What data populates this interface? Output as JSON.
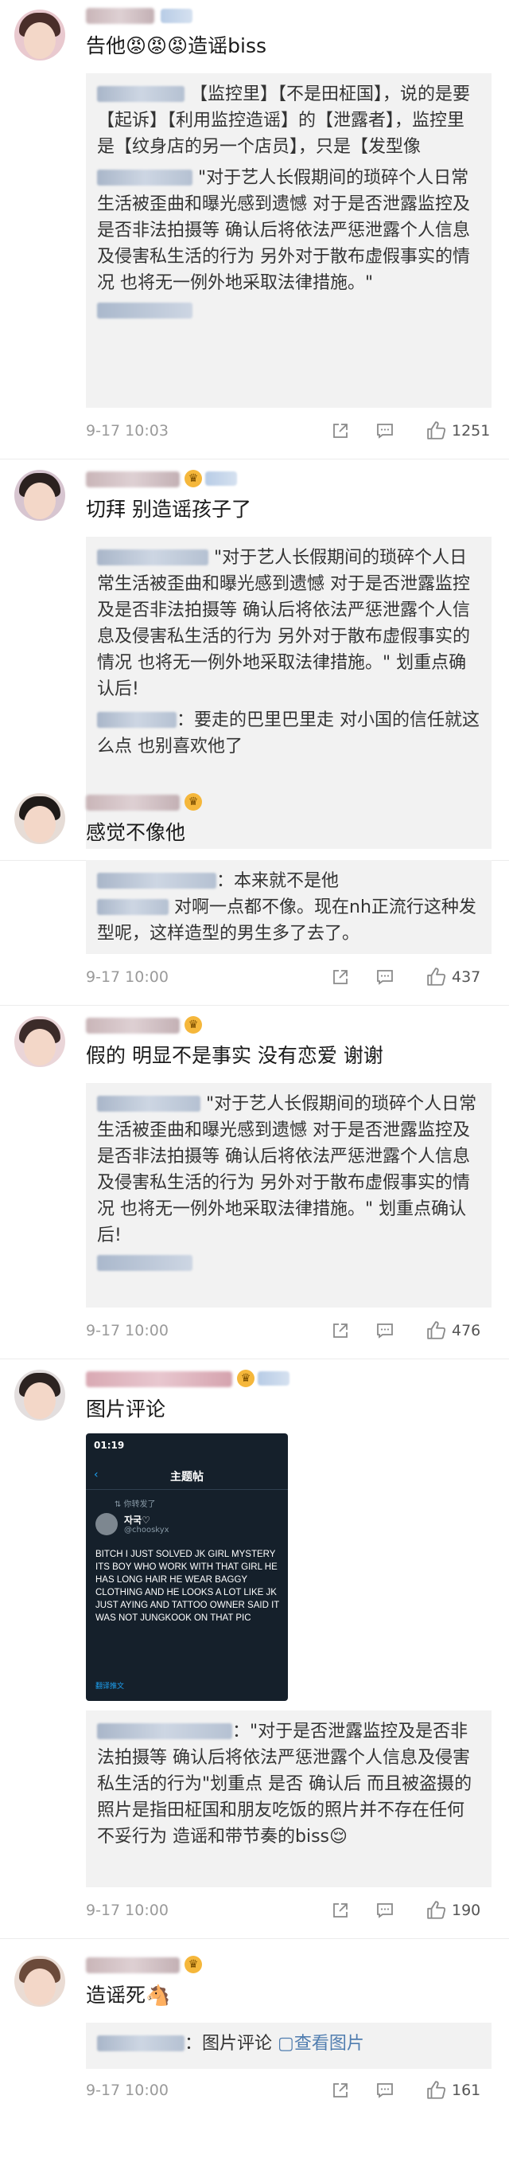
{
  "comments": [
    {
      "text": "告他😡😡😡造谣biss",
      "replies": [
        {
          "text": "【监控里】【不是田柾国】，说的是要【起诉】【利用监控造谣】的【泄露者】，监控里是【纹身店的另一个店员】，只是【发型像"
        },
        {
          "text": "\"对于艺人长假期间的琐碎个人日常生活被歪曲和曝光感到遗憾 对于是否泄露监控及是否非法拍摄等 确认后将依法严惩泄露个人信息及侵害私生活的行为 另外对于散布虚假事实的情况 也将无一例外地采取法律措施。\""
        }
      ],
      "time": "9-17 10:03",
      "likes": "1251"
    },
    {
      "text": "切拜 别造谣孩子了",
      "replies": [
        {
          "text": "\"对于艺人长假期间的琐碎个人日常生活被歪曲和曝光感到遗憾 对于是否泄露监控及是否非法拍摄等 确认后将依法严惩泄露个人信息及侵害私生活的行为 另外对于散布虚假事实的情况 也将无一例外地采取法律措施。\" 划重点确认后!"
        },
        {
          "text": "：要走的巴里巴里走 对小国的信任就这么点 也别喜欢他了"
        }
      ]
    },
    {
      "text": "感觉不像他",
      "replies": [
        {
          "text": "：本来就不是他"
        },
        {
          "text": "对啊一点都不像。现在nh正流行这种发型呢，这样造型的男生多了去了。"
        }
      ],
      "time": "9-17 10:00",
      "likes": "437"
    },
    {
      "text": "假的 明显不是事实 没有恋爱 谢谢",
      "replies": [
        {
          "text": "\"对于艺人长假期间的琐碎个人日常生活被歪曲和曝光感到遗憾 对于是否泄露监控及是否非法拍摄等 确认后将依法严惩泄露个人信息及侵害私生活的行为 另外对于散布虚假事实的情况 也将无一例外地采取法律措施。\" 划重点确认后!"
        }
      ],
      "time": "9-17 10:00",
      "likes": "476"
    },
    {
      "text": "图片评论",
      "screenshot": {
        "status_time": "01:19",
        "title": "主题帖",
        "retweet": "⇅ 你转发了",
        "name": "자국♡",
        "handle": "@chooskyx",
        "body": "BITCH I JUST SOLVED JK GIRL MYSTERY ITS BOY WHO WORK WITH THAT GIRL HE HAS LONG HAIR HE WEAR BAGGY CLOTHING AND HE LOOKS A LOT LIKE JK JUST AYING AND TATTOO OWNER SAID IT WAS NOT JUNGKOOK ON THAT PIC",
        "footer": "翻译推文"
      },
      "replies": [
        {
          "text": "：\"对于是否泄露监控及是否非法拍摄等 确认后将依法严惩泄露个人信息及侵害私生活的行为\"划重点 是否 确认后 而且被盗摄的照片是指田柾国和朋友吃饭的照片并不存在任何不妥行为 造谣和带节奏的biss😌"
        }
      ],
      "time": "9-17 10:00",
      "likes": "190"
    },
    {
      "text": "造谣死🐴",
      "replies": [
        {
          "text": "：图片评论",
          "link": "查看图片"
        }
      ],
      "time": "9-17 10:00",
      "likes": "161"
    }
  ],
  "colors": {
    "reply_bg": "#f2f2f2",
    "meta": "#9a9a9a",
    "link": "#507daf"
  }
}
